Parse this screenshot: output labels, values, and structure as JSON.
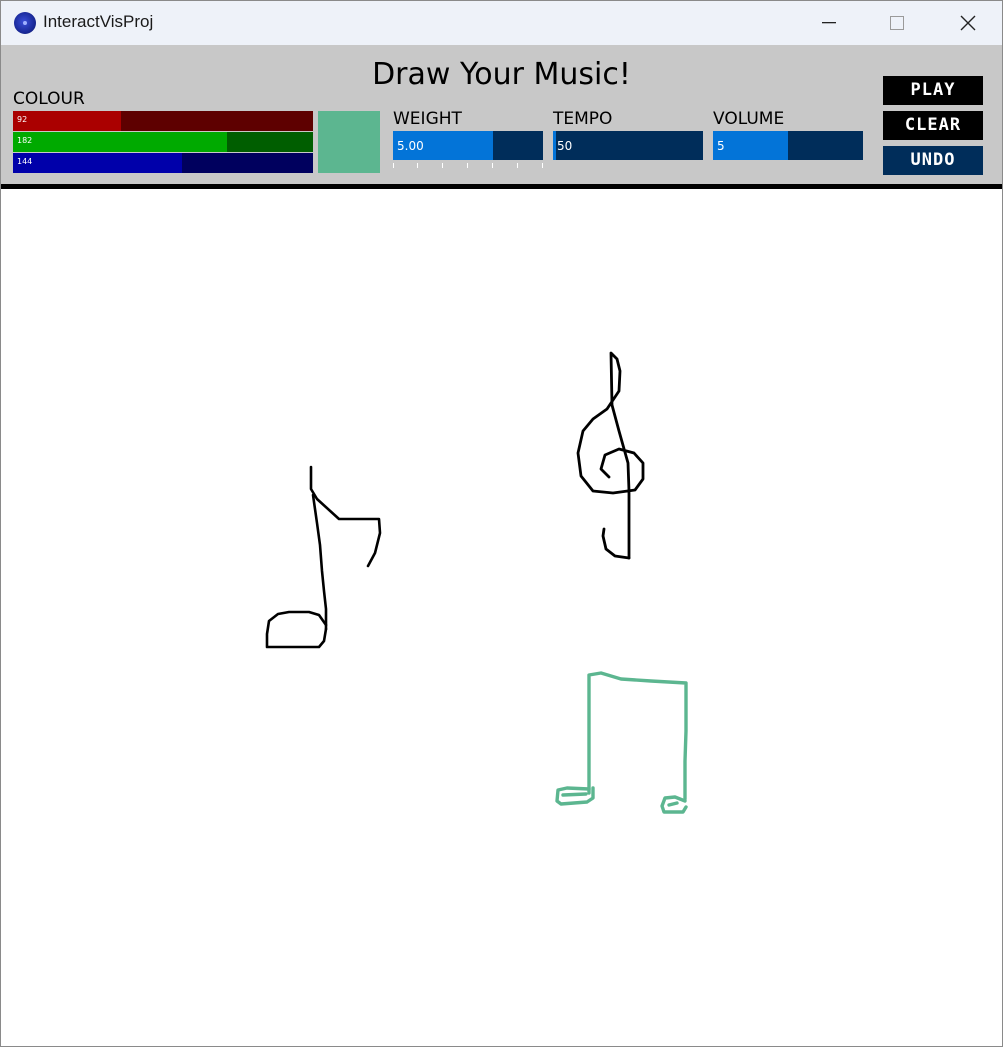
{
  "window": {
    "title": "InteractVisProj",
    "icon": "app-icon",
    "controls": [
      "minimize-icon",
      "maximize-icon",
      "close-icon"
    ]
  },
  "app": {
    "title": "Draw Your Music!"
  },
  "colour": {
    "label": "COLOUR",
    "red": {
      "value": "92",
      "level": 92,
      "max": 255,
      "fill_color": "#aa0000",
      "track_color": "#5e0000"
    },
    "green": {
      "value": "182",
      "level": 182,
      "max": 255,
      "fill_color": "#00aa00",
      "track_color": "#005e00"
    },
    "blue": {
      "value": "144",
      "level": 144,
      "max": 255,
      "fill_color": "#0000aa",
      "track_color": "#00005e"
    },
    "preview_color": "#5cb690"
  },
  "weight": {
    "label": "WEIGHT",
    "value": "5.00",
    "level_fraction": 0.667
  },
  "tempo": {
    "label": "TEMPO",
    "value": "50",
    "level_fraction": 0.02
  },
  "volume": {
    "label": "VOLUME",
    "value": "5",
    "level_fraction": 0.5
  },
  "buttons": {
    "play": "PLAY",
    "clear": "CLEAR",
    "undo": "UNDO"
  },
  "colors": {
    "toolbar_bg": "#c8c8c8",
    "slider_track": "#002d5a",
    "slider_fill": "#0374d8",
    "button_bg": "#000000",
    "button_hover_bg": "#002d5a",
    "stroke_black": "#000000",
    "stroke_teal": "#5cb690"
  },
  "drawing": {
    "strokes": [
      "eighth-note",
      "treble-clef",
      "beamed-notes"
    ]
  }
}
